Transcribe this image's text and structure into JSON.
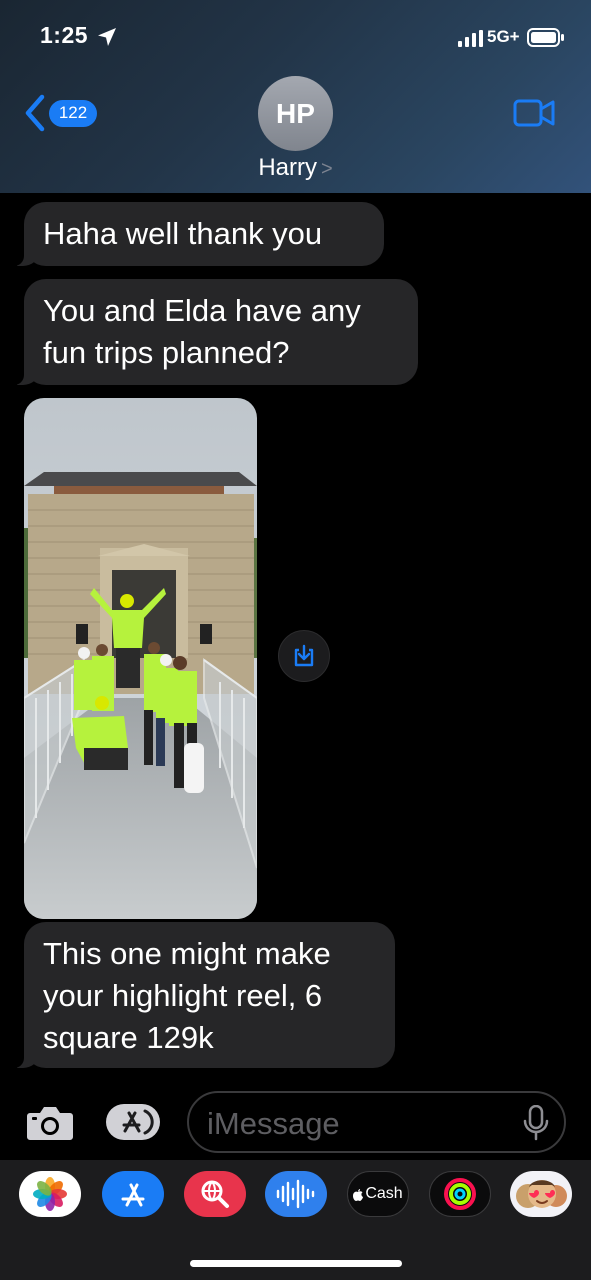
{
  "status_bar": {
    "time": "1:25",
    "network": "5G+"
  },
  "header": {
    "back_count": "122",
    "avatar_initials": "HP",
    "contact_name": "Harry",
    "contact_chevron": ">"
  },
  "messages": [
    {
      "type": "text",
      "text": "Haha well thank you"
    },
    {
      "type": "text",
      "lines": [
        "You and Elda have any",
        "fun trips planned?"
      ]
    },
    {
      "type": "photo",
      "icon": "photo-workers-on-bridge"
    },
    {
      "type": "text",
      "lines": [
        "This one might make",
        "your highlight reel, 6",
        "square 129k"
      ]
    }
  ],
  "input_bar": {
    "placeholder": "iMessage"
  },
  "app_drawer": {
    "items": [
      {
        "icon": "photos-app-icon"
      },
      {
        "icon": "app-store-icon"
      },
      {
        "icon": "images-search-icon"
      },
      {
        "icon": "audio-message-icon"
      },
      {
        "icon": "apple-cash-icon",
        "label": "Cash"
      },
      {
        "icon": "fitness-icon"
      },
      {
        "icon": "memoji-icon"
      }
    ]
  },
  "colors": {
    "accent": "#1a7cf5",
    "bubble_incoming": "#262628",
    "background": "#000000"
  }
}
